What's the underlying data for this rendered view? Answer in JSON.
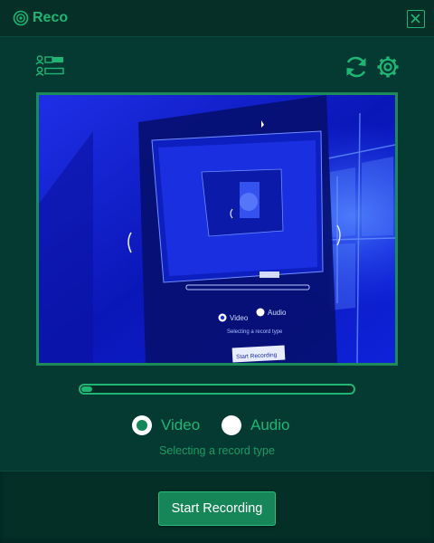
{
  "app": {
    "title": "Reco"
  },
  "recording": {
    "progress": 0.04,
    "options": [
      {
        "label": "Video",
        "selected": true
      },
      {
        "label": "Audio",
        "selected": false
      }
    ],
    "hint": "Selecting a record type",
    "start_label": "Start Recording"
  },
  "preview": {
    "mini_video_label": "Video",
    "mini_audio_label": "Audio",
    "mini_hint": "Selecting a record type",
    "mini_start_label": "Start Recording"
  },
  "colors": {
    "accent": "#1fb574",
    "background": "#043a31",
    "titlebar": "#063027",
    "button": "#168659",
    "preview_blue": "#0d1fd0"
  },
  "icons": {
    "logo": "record-logo-icon",
    "close": "close-icon",
    "layout": "user-list-icon",
    "refresh": "refresh-icon",
    "settings": "gear-icon"
  }
}
